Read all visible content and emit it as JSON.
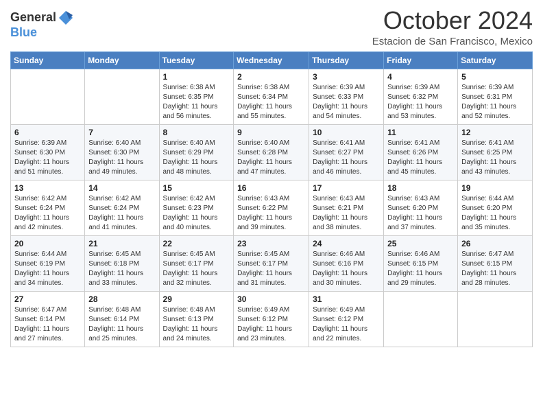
{
  "header": {
    "logo_general": "General",
    "logo_blue": "Blue",
    "month": "October 2024",
    "location": "Estacion de San Francisco, Mexico"
  },
  "days_of_week": [
    "Sunday",
    "Monday",
    "Tuesday",
    "Wednesday",
    "Thursday",
    "Friday",
    "Saturday"
  ],
  "weeks": [
    [
      {
        "day": "",
        "lines": []
      },
      {
        "day": "",
        "lines": []
      },
      {
        "day": "1",
        "lines": [
          "Sunrise: 6:38 AM",
          "Sunset: 6:35 PM",
          "Daylight: 11 hours and 56 minutes."
        ]
      },
      {
        "day": "2",
        "lines": [
          "Sunrise: 6:38 AM",
          "Sunset: 6:34 PM",
          "Daylight: 11 hours and 55 minutes."
        ]
      },
      {
        "day": "3",
        "lines": [
          "Sunrise: 6:39 AM",
          "Sunset: 6:33 PM",
          "Daylight: 11 hours and 54 minutes."
        ]
      },
      {
        "day": "4",
        "lines": [
          "Sunrise: 6:39 AM",
          "Sunset: 6:32 PM",
          "Daylight: 11 hours and 53 minutes."
        ]
      },
      {
        "day": "5",
        "lines": [
          "Sunrise: 6:39 AM",
          "Sunset: 6:31 PM",
          "Daylight: 11 hours and 52 minutes."
        ]
      }
    ],
    [
      {
        "day": "6",
        "lines": [
          "Sunrise: 6:39 AM",
          "Sunset: 6:30 PM",
          "Daylight: 11 hours and 51 minutes."
        ]
      },
      {
        "day": "7",
        "lines": [
          "Sunrise: 6:40 AM",
          "Sunset: 6:30 PM",
          "Daylight: 11 hours and 49 minutes."
        ]
      },
      {
        "day": "8",
        "lines": [
          "Sunrise: 6:40 AM",
          "Sunset: 6:29 PM",
          "Daylight: 11 hours and 48 minutes."
        ]
      },
      {
        "day": "9",
        "lines": [
          "Sunrise: 6:40 AM",
          "Sunset: 6:28 PM",
          "Daylight: 11 hours and 47 minutes."
        ]
      },
      {
        "day": "10",
        "lines": [
          "Sunrise: 6:41 AM",
          "Sunset: 6:27 PM",
          "Daylight: 11 hours and 46 minutes."
        ]
      },
      {
        "day": "11",
        "lines": [
          "Sunrise: 6:41 AM",
          "Sunset: 6:26 PM",
          "Daylight: 11 hours and 45 minutes."
        ]
      },
      {
        "day": "12",
        "lines": [
          "Sunrise: 6:41 AM",
          "Sunset: 6:25 PM",
          "Daylight: 11 hours and 43 minutes."
        ]
      }
    ],
    [
      {
        "day": "13",
        "lines": [
          "Sunrise: 6:42 AM",
          "Sunset: 6:24 PM",
          "Daylight: 11 hours and 42 minutes."
        ]
      },
      {
        "day": "14",
        "lines": [
          "Sunrise: 6:42 AM",
          "Sunset: 6:24 PM",
          "Daylight: 11 hours and 41 minutes."
        ]
      },
      {
        "day": "15",
        "lines": [
          "Sunrise: 6:42 AM",
          "Sunset: 6:23 PM",
          "Daylight: 11 hours and 40 minutes."
        ]
      },
      {
        "day": "16",
        "lines": [
          "Sunrise: 6:43 AM",
          "Sunset: 6:22 PM",
          "Daylight: 11 hours and 39 minutes."
        ]
      },
      {
        "day": "17",
        "lines": [
          "Sunrise: 6:43 AM",
          "Sunset: 6:21 PM",
          "Daylight: 11 hours and 38 minutes."
        ]
      },
      {
        "day": "18",
        "lines": [
          "Sunrise: 6:43 AM",
          "Sunset: 6:20 PM",
          "Daylight: 11 hours and 37 minutes."
        ]
      },
      {
        "day": "19",
        "lines": [
          "Sunrise: 6:44 AM",
          "Sunset: 6:20 PM",
          "Daylight: 11 hours and 35 minutes."
        ]
      }
    ],
    [
      {
        "day": "20",
        "lines": [
          "Sunrise: 6:44 AM",
          "Sunset: 6:19 PM",
          "Daylight: 11 hours and 34 minutes."
        ]
      },
      {
        "day": "21",
        "lines": [
          "Sunrise: 6:45 AM",
          "Sunset: 6:18 PM",
          "Daylight: 11 hours and 33 minutes."
        ]
      },
      {
        "day": "22",
        "lines": [
          "Sunrise: 6:45 AM",
          "Sunset: 6:17 PM",
          "Daylight: 11 hours and 32 minutes."
        ]
      },
      {
        "day": "23",
        "lines": [
          "Sunrise: 6:45 AM",
          "Sunset: 6:17 PM",
          "Daylight: 11 hours and 31 minutes."
        ]
      },
      {
        "day": "24",
        "lines": [
          "Sunrise: 6:46 AM",
          "Sunset: 6:16 PM",
          "Daylight: 11 hours and 30 minutes."
        ]
      },
      {
        "day": "25",
        "lines": [
          "Sunrise: 6:46 AM",
          "Sunset: 6:15 PM",
          "Daylight: 11 hours and 29 minutes."
        ]
      },
      {
        "day": "26",
        "lines": [
          "Sunrise: 6:47 AM",
          "Sunset: 6:15 PM",
          "Daylight: 11 hours and 28 minutes."
        ]
      }
    ],
    [
      {
        "day": "27",
        "lines": [
          "Sunrise: 6:47 AM",
          "Sunset: 6:14 PM",
          "Daylight: 11 hours and 27 minutes."
        ]
      },
      {
        "day": "28",
        "lines": [
          "Sunrise: 6:48 AM",
          "Sunset: 6:14 PM",
          "Daylight: 11 hours and 25 minutes."
        ]
      },
      {
        "day": "29",
        "lines": [
          "Sunrise: 6:48 AM",
          "Sunset: 6:13 PM",
          "Daylight: 11 hours and 24 minutes."
        ]
      },
      {
        "day": "30",
        "lines": [
          "Sunrise: 6:49 AM",
          "Sunset: 6:12 PM",
          "Daylight: 11 hours and 23 minutes."
        ]
      },
      {
        "day": "31",
        "lines": [
          "Sunrise: 6:49 AM",
          "Sunset: 6:12 PM",
          "Daylight: 11 hours and 22 minutes."
        ]
      },
      {
        "day": "",
        "lines": []
      },
      {
        "day": "",
        "lines": []
      }
    ]
  ]
}
